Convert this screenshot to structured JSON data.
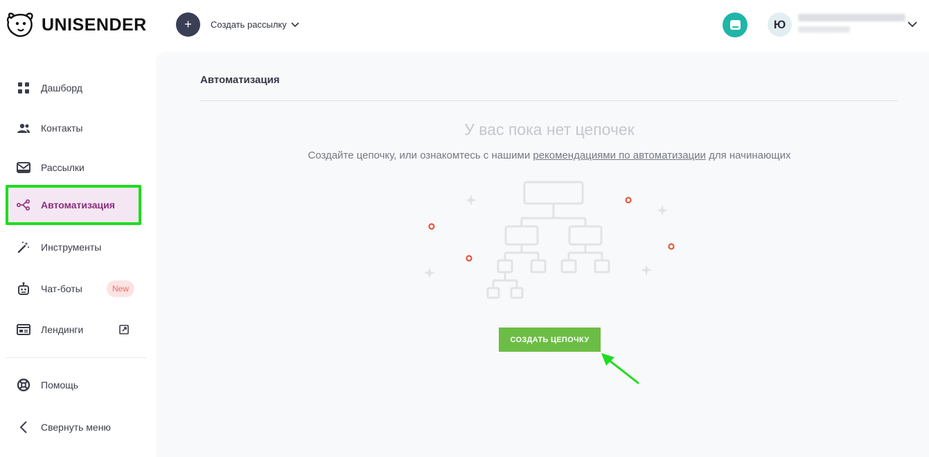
{
  "header": {
    "logo_text": "UNISENDER",
    "create_label": "Создать рассылку",
    "avatar_letter": "Ю"
  },
  "sidebar": {
    "items": [
      {
        "label": "Дашборд",
        "icon": "dashboard-grid-icon"
      },
      {
        "label": "Контакты",
        "icon": "contacts-icon"
      },
      {
        "label": "Рассылки",
        "icon": "mail-icon"
      },
      {
        "label": "Автоматизация",
        "icon": "automation-icon",
        "active": true
      },
      {
        "label": "Инструменты",
        "icon": "magic-wand-icon"
      },
      {
        "label": "Чат-боты",
        "icon": "robot-icon",
        "badge": "New"
      },
      {
        "label": "Лендинги",
        "icon": "landing-icon"
      },
      {
        "label": "Помощь",
        "icon": "help-lifebuoy-icon"
      },
      {
        "label": "Свернуть меню",
        "icon": "chevron-left-icon"
      }
    ]
  },
  "main": {
    "page_title": "Автоматизация",
    "empty_title": "У вас пока нет цепочек",
    "empty_desc_before": "Создайте цепочку, или ознакомтесь с нашими ",
    "empty_desc_link": "рекомендациями по автоматизации",
    "empty_desc_after": " для начинающих",
    "cta_label": "СОЗДАТЬ ЦЕПОЧКУ"
  },
  "colors": {
    "active_bg": "#f4e6f2",
    "active_text": "#8b2f7e",
    "highlight": "#1fdc1f",
    "cta": "#6cbd45",
    "chat": "#1fb5a7"
  }
}
